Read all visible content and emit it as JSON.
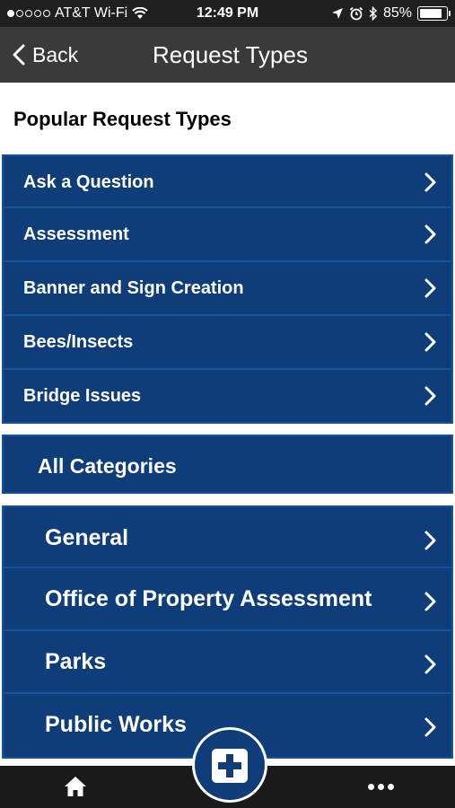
{
  "status_bar": {
    "carrier": "AT&T Wi-Fi",
    "time": "12:49 PM",
    "battery": "85%",
    "battery_level": 0.85,
    "signal_bars_filled": 1,
    "icons": [
      "signal-dots-icon",
      "wifi-icon",
      "location-arrow-icon",
      "alarm-icon",
      "bluetooth-icon",
      "battery-icon"
    ]
  },
  "nav": {
    "back_label": "Back",
    "title": "Request Types"
  },
  "popular": {
    "heading": "Popular Request Types",
    "items": [
      {
        "label": "Ask a Question"
      },
      {
        "label": "Assessment"
      },
      {
        "label": "Banner and Sign Creation"
      },
      {
        "label": "Bees/Insects"
      },
      {
        "label": "Bridge Issues"
      }
    ]
  },
  "categories": {
    "heading": "All Categories",
    "items": [
      {
        "label": "General"
      },
      {
        "label": "Office of Property Assessment"
      },
      {
        "label": "Parks"
      },
      {
        "label": "Public Works"
      }
    ]
  },
  "tab_bar": {
    "icons": [
      "home-icon",
      "plus-icon",
      "more-icon"
    ]
  },
  "colors": {
    "row_bg": "#0f3d79",
    "row_border": "#1552a0",
    "nav_bg": "#3a3a3a",
    "status_bg": "#1f1f1f",
    "tab_bg": "#1a1a1a"
  }
}
